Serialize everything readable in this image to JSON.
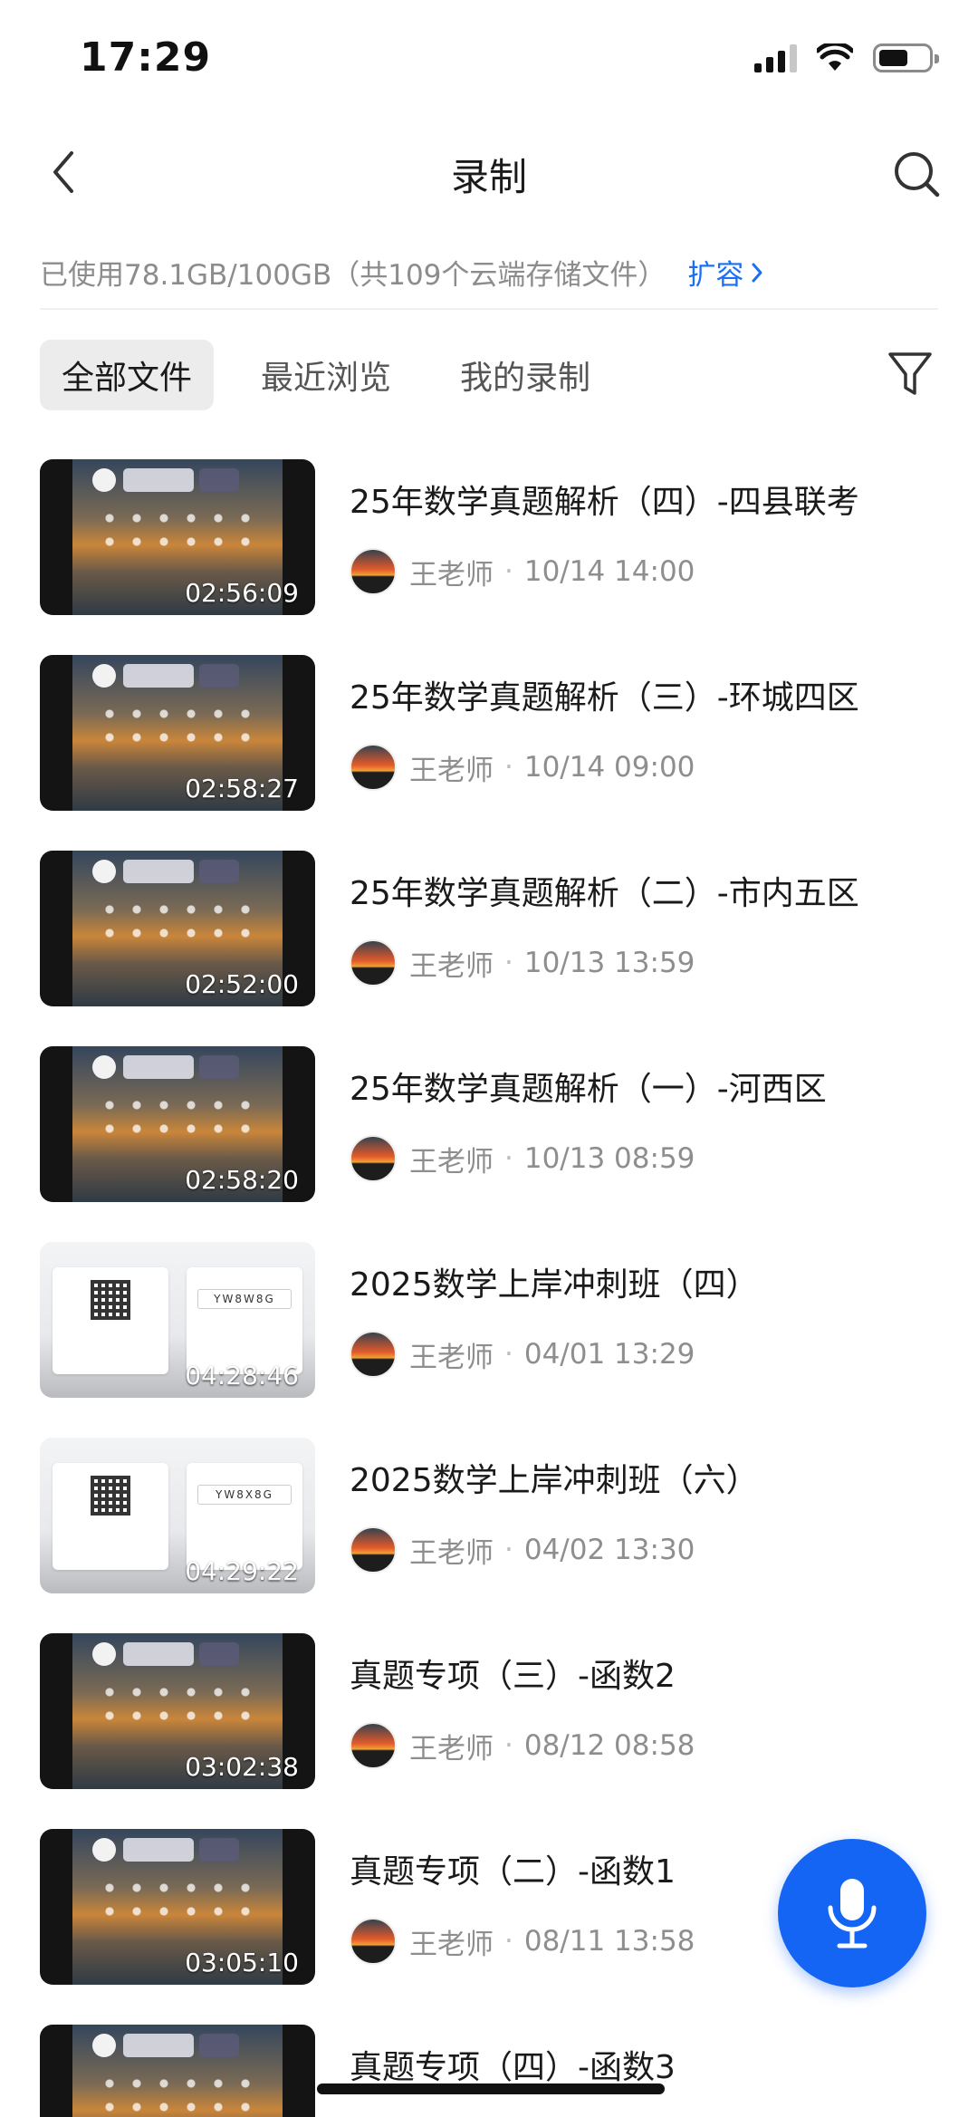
{
  "status_bar": {
    "time": "17:29",
    "signal_icon": "signal-icon",
    "wifi_icon": "wifi-icon",
    "battery_icon": "battery-icon",
    "battery_level": 0.6
  },
  "nav": {
    "back_icon": "chevron-left-icon",
    "title": "录制",
    "search_icon": "search-icon"
  },
  "storage": {
    "text": "已使用78.1GB/100GB（共109个云端存储文件）",
    "expand_label": "扩容",
    "expand_icon": "chevron-right-icon"
  },
  "tabs": [
    {
      "label": "全部文件",
      "active": true
    },
    {
      "label": "最近浏览",
      "active": false
    },
    {
      "label": "我的录制",
      "active": false
    }
  ],
  "filter_icon": "filter-icon",
  "recordings": [
    {
      "title": "25年数学真题解析（四）-四县联考",
      "duration": "02:56:09",
      "author": "王老师",
      "datetime": "10/14 14:00",
      "style": "dark",
      "code": ""
    },
    {
      "title": "25年数学真题解析（三）-环城四区",
      "duration": "02:58:27",
      "author": "王老师",
      "datetime": "10/14 09:00",
      "style": "dark",
      "code": ""
    },
    {
      "title": "25年数学真题解析（二）-市内五区",
      "duration": "02:52:00",
      "author": "王老师",
      "datetime": "10/13 13:59",
      "style": "dark",
      "code": ""
    },
    {
      "title": "25年数学真题解析（一）-河西区",
      "duration": "02:58:20",
      "author": "王老师",
      "datetime": "10/13 08:59",
      "style": "dark",
      "code": ""
    },
    {
      "title": "2025数学上岸冲刺班（四）",
      "duration": "04:28:46",
      "author": "王老师",
      "datetime": "04/01 13:29",
      "style": "light",
      "code": "YW8W8G"
    },
    {
      "title": "2025数学上岸冲刺班（六）",
      "duration": "04:29:22",
      "author": "王老师",
      "datetime": "04/02 13:30",
      "style": "light",
      "code": "YW8X8G"
    },
    {
      "title": "真题专项（三）-函数2",
      "duration": "03:02:38",
      "author": "王老师",
      "datetime": "08/12 08:58",
      "style": "dark",
      "code": ""
    },
    {
      "title": "真题专项（二）-函数1",
      "duration": "03:05:10",
      "author": "王老师",
      "datetime": "08/11 13:58",
      "style": "dark",
      "code": ""
    },
    {
      "title": "真题专项（四）-函数3",
      "duration": "",
      "author": "",
      "datetime": "",
      "style": "dark",
      "code": ""
    }
  ],
  "fab": {
    "icon": "microphone-icon"
  },
  "colors": {
    "accent": "#1565f5",
    "link": "#1a6ff2",
    "text": "#1a1a1a",
    "muted": "#8e8e8e",
    "tab_active_bg": "#ececec"
  }
}
